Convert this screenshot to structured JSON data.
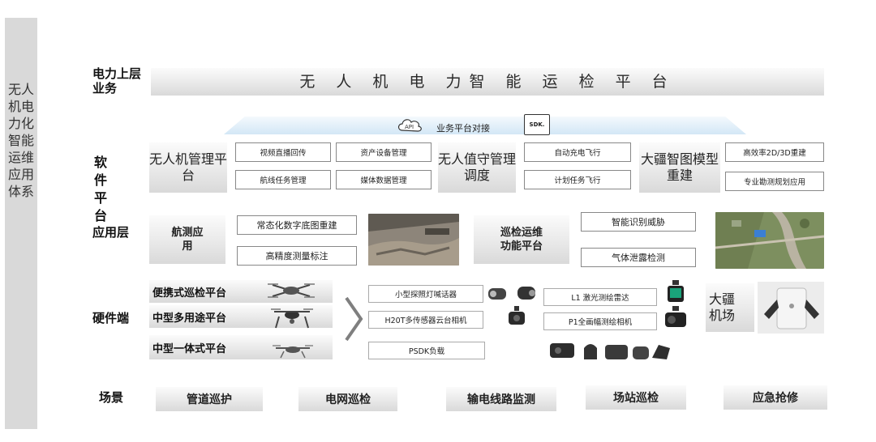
{
  "sidebar": {
    "label": "无人机电力化智能运维应用体系"
  },
  "sections": {
    "upper": "电力上层业务",
    "software": "软 件 平 台",
    "app": "应用层",
    "hardware": "硬件端",
    "scene": "场景"
  },
  "top_bar": {
    "title": "无 人 机 电 力智 能 运 检 平 台"
  },
  "api_band": {
    "api_icon_text": "API",
    "label": "业务平台对接",
    "sdk_icon_text": "SDK."
  },
  "software": {
    "uav_platform": "无人机管理平台",
    "uav_platform_boxes": [
      "视频直播回传",
      "航线任务管理"
    ],
    "asset_boxes": [
      "资产设备管理",
      "媒体数据管理"
    ],
    "duty_platform": "无人值守管理调度",
    "duty_boxes": [
      "自动充电飞行",
      "计划任务飞行"
    ],
    "dji_model": "大疆智图模型重建",
    "dji_model_boxes": [
      "高效率2D/3D重建",
      "专业勘测规划应用"
    ]
  },
  "app_layer": {
    "survey": "航测应用",
    "survey_boxes": [
      "常态化数字底图重建",
      "高精度测量标注"
    ],
    "inspect": "巡检运维功能平台",
    "inspect_boxes": [
      "智能识别威胁",
      "气体泄露检测"
    ]
  },
  "hardware": {
    "platforms": [
      "便携式巡检平台",
      "中型多用途平台",
      "中型一体式平台"
    ],
    "payload_boxes_left": [
      "小型探照灯喊话器",
      "H20T多传感器云台相机",
      "PSDK负载"
    ],
    "payload_boxes_right": [
      "L1 激光测绘雷达",
      "P1全画幅测绘相机"
    ],
    "dock": "大疆机场"
  },
  "scenes": [
    "管道巡护",
    "电网巡检",
    "输电线路监测",
    "场站巡检",
    "应急抢修"
  ],
  "colors": {
    "sidebar": "#d9d9d9",
    "band": "#d3e7f6",
    "bar_light": "#fbfbfb",
    "bar_dark": "#d9d9d9"
  }
}
